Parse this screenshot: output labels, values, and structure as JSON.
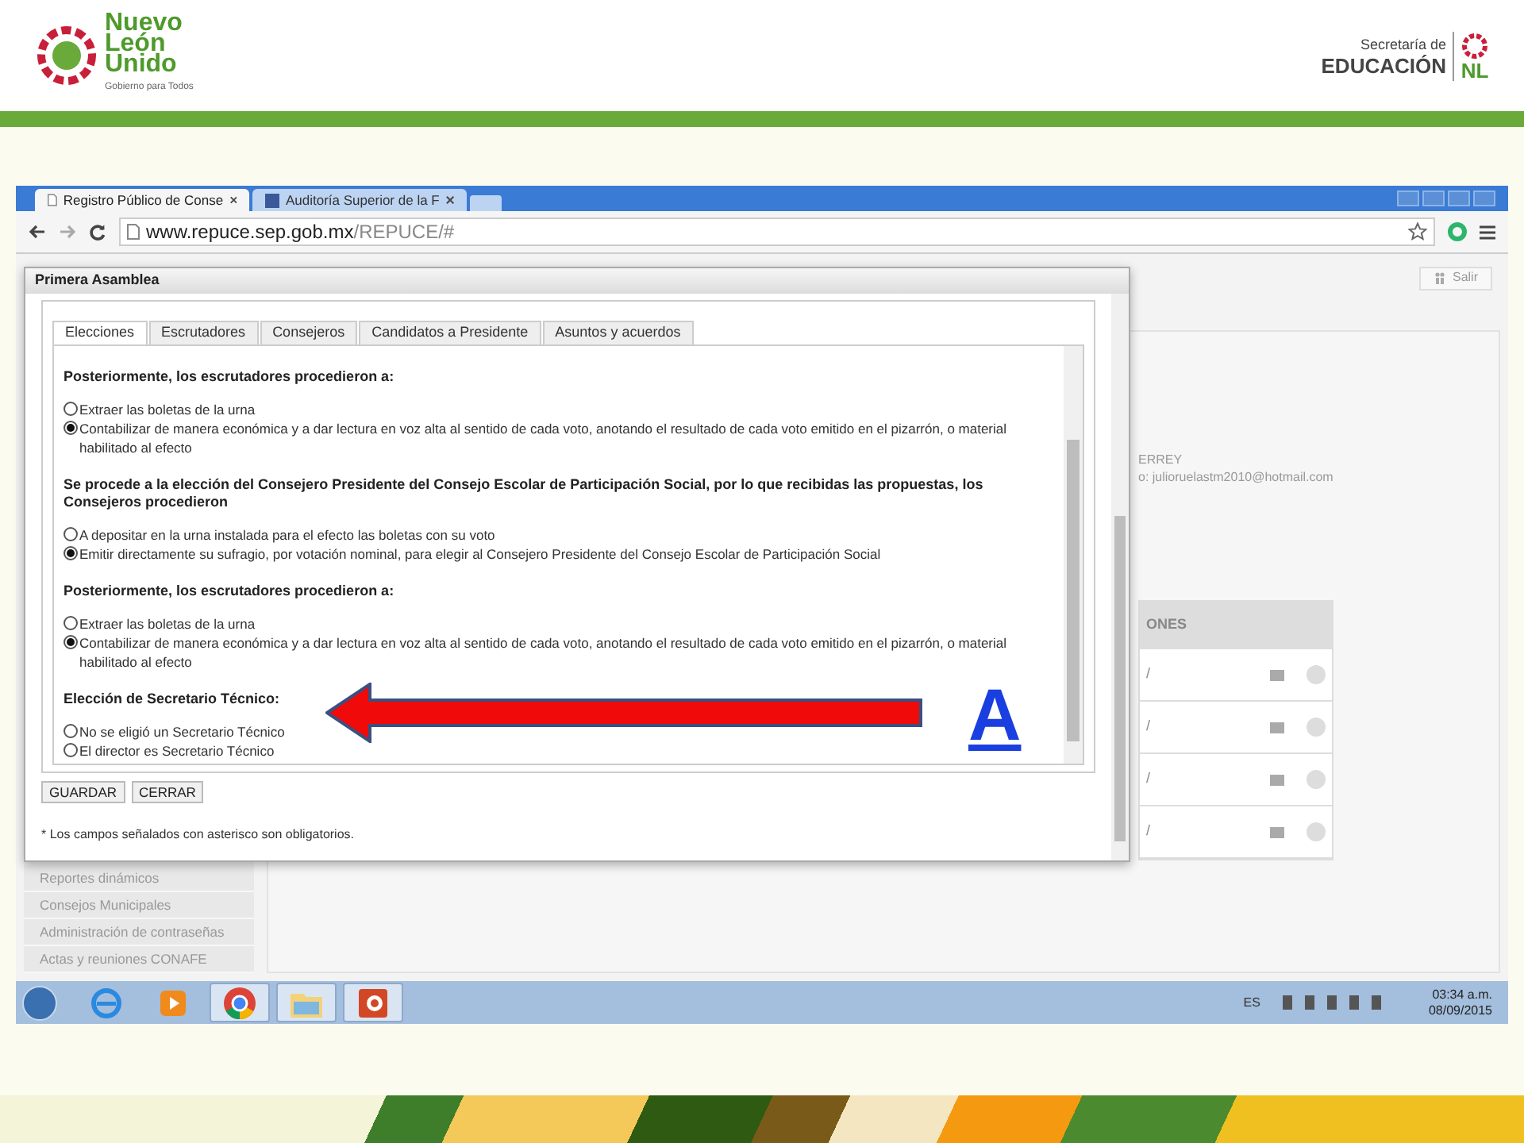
{
  "slide_header": {
    "left_logo": {
      "lines": [
        "Nuevo",
        "León",
        "Unido"
      ],
      "tagline": "Gobierno para Todos"
    },
    "right_logo": {
      "line1": "Secretaría de",
      "line2": "EDUCACIÓN",
      "mark": "NL"
    }
  },
  "browser": {
    "tabs": [
      {
        "title": "Registro Público de Conse",
        "selected": true,
        "kind": "page"
      },
      {
        "title": "Auditoría Superior de la F",
        "selected": false,
        "kind": "facebook"
      }
    ],
    "url_host": "www.repuce.sep.gob.mx",
    "url_path": "/REPUCE/#"
  },
  "page": {
    "logout_button": "Salir",
    "info_lines": [
      "ERREY",
      "o: julioruelastm2010@hotmail.com"
    ],
    "table_header": "ONES",
    "table_rows": [
      {
        "column_1": "/"
      },
      {
        "column_1": "/"
      },
      {
        "column_1": "/"
      },
      {
        "column_1": "/"
      }
    ],
    "sidebar": [
      "Reportes dinámicos",
      "Consejos Municipales",
      "Administración de contraseñas",
      "Actas y reuniones CONAFE"
    ]
  },
  "modal": {
    "title": "Primera Asamblea",
    "tabs": [
      {
        "label": "Elecciones",
        "selected": true
      },
      {
        "label": "Escrutadores",
        "selected": false
      },
      {
        "label": "Consejeros",
        "selected": false
      },
      {
        "label": "Candidatos a Presidente",
        "selected": false
      },
      {
        "label": "Asuntos y acuerdos",
        "selected": false
      }
    ],
    "questions": [
      {
        "title": "Posteriormente, los escrutadores procedieron a:",
        "options": [
          {
            "label": "Extraer las boletas de la urna",
            "selected": false
          },
          {
            "label": "Contabilizar de manera económica y a dar lectura en voz alta al sentido de cada voto, anotando el resultado de cada voto emitido en el pizarrón, o material habilitado al efecto",
            "selected": true
          }
        ]
      },
      {
        "title": "Se procede a la elección del Consejero Presidente del Consejo Escolar de Participación Social, por lo que recibidas las propuestas, los Consejeros procedieron",
        "options": [
          {
            "label": "A depositar en la urna instalada para el efecto las boletas con su voto",
            "selected": false
          },
          {
            "label": "Emitir directamente su sufragio, por votación nominal, para elegir al Consejero Presidente del Consejo Escolar de Participación Social",
            "selected": true
          }
        ]
      },
      {
        "title": "Posteriormente, los escrutadores procedieron a:",
        "options": [
          {
            "label": "Extraer las boletas de la urna",
            "selected": false
          },
          {
            "label": "Contabilizar de manera económica y a dar lectura en voz alta al sentido de cada voto, anotando el resultado de cada voto emitido en el pizarrón, o material habilitado al efecto",
            "selected": true
          }
        ]
      },
      {
        "title": "Elección de Secretario Técnico:",
        "options": [
          {
            "label": "No se eligió un Secretario Técnico",
            "selected": false
          },
          {
            "label": "El director es Secretario Técnico",
            "selected": false
          }
        ]
      }
    ],
    "buttons": [
      "GUARDAR",
      "CERRAR"
    ],
    "note": "* Los campos señalados con asterisco son obligatorios."
  },
  "annotation": {
    "letter": "A"
  },
  "taskbar": {
    "apps": [
      {
        "kind": "ie",
        "selected": false
      },
      {
        "kind": "media",
        "selected": false
      },
      {
        "kind": "chrome",
        "selected": true
      },
      {
        "kind": "explorer",
        "selected": true
      },
      {
        "kind": "powerpoint",
        "selected": true
      }
    ],
    "language": "ES",
    "time": "03:34 a.m.",
    "date": "08/09/2015"
  }
}
